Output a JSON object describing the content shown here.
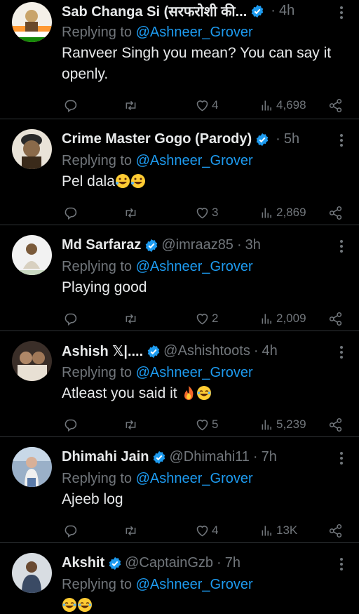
{
  "replying_prefix": "Replying to",
  "tweets": [
    {
      "name": "Sab Changa Si (सरफरोशी की...",
      "handle": "",
      "time": "4h",
      "mention": "@Ashneer_Grover",
      "text": "Ranveer Singh you mean? You can say it openly.",
      "likes": "4",
      "views": "4,698",
      "avatar_color": "#c9a46a"
    },
    {
      "name": "Crime Master Gogo (Parody)",
      "handle": "",
      "time": "5h",
      "mention": "@Ashneer_Grover",
      "text": "Pel dala",
      "emojis": [
        "rofl-emoji",
        "rofl-emoji"
      ],
      "likes": "3",
      "views": "2,869",
      "avatar_color": "#8a6a4a"
    },
    {
      "name": "Md Sarfaraz",
      "handle": "@imraaz85",
      "time": "3h",
      "mention": "@Ashneer_Grover",
      "text": "Playing good",
      "likes": "2",
      "views": "2,009",
      "avatar_color": "#f2f2f2"
    },
    {
      "name": "Ashish 𝕏|....",
      "handle": "@Ashishtoots",
      "time": "4h",
      "mention": "@Ashneer_Grover",
      "text": "Atleast you said it ",
      "emojis": [
        "fire-emoji",
        "joy-emoji"
      ],
      "likes": "5",
      "views": "5,239",
      "avatar_color": "#6b5a4a"
    },
    {
      "name": "Dhimahi Jain",
      "handle": "@Dhimahi11",
      "time": "7h",
      "mention": "@Ashneer_Grover",
      "text": "Ajeeb log",
      "likes": "4",
      "views": "13K",
      "avatar_color": "#9ab0c8"
    },
    {
      "name": "Akshit",
      "handle": "@CaptainGzb",
      "time": "7h",
      "mention": "@Ashneer_Grover",
      "text": "",
      "emojis": [
        "joy-emoji",
        "joy-emoji"
      ],
      "likes": "",
      "views": "",
      "avatar_color": "#d8dde2"
    }
  ],
  "colors": {
    "background": "#000000",
    "accent": "#1d9bf0",
    "muted": "#71767b",
    "text": "#e7e9ea",
    "divider": "#2f3336"
  }
}
